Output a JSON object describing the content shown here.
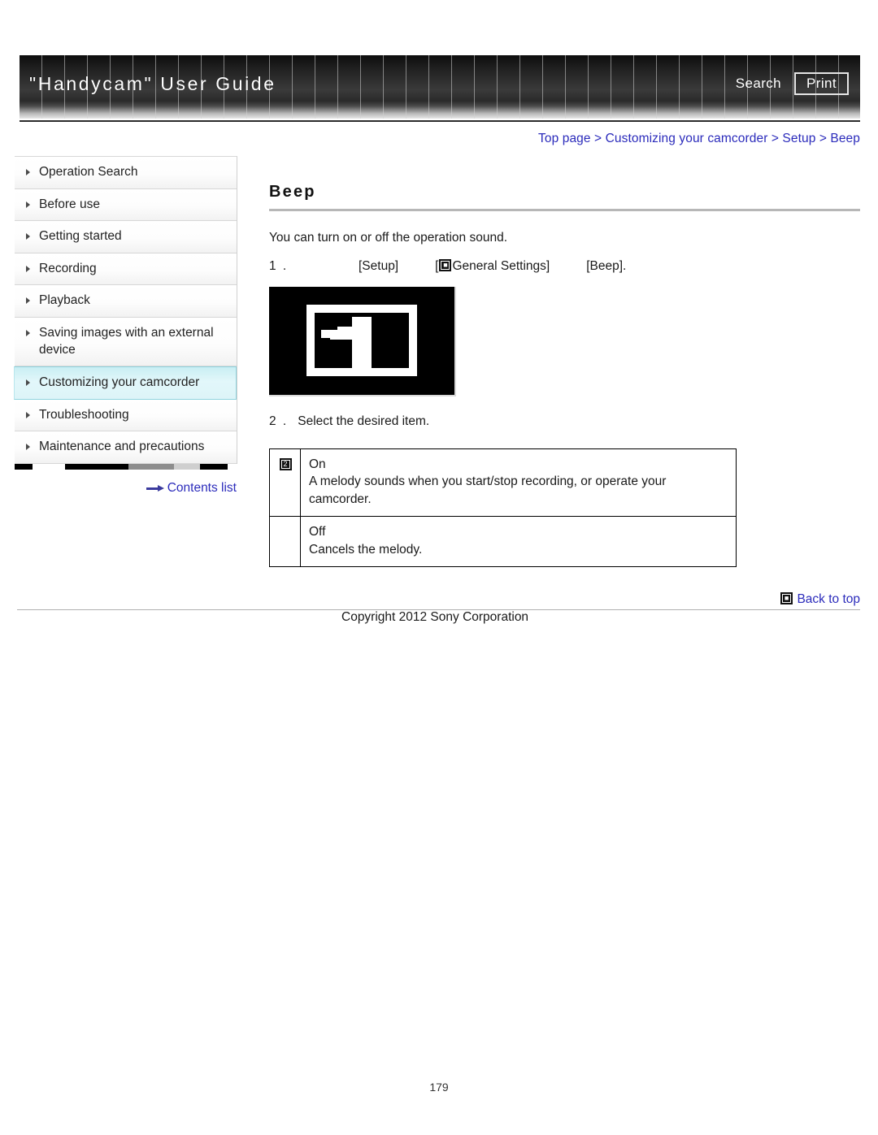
{
  "header": {
    "title": "\"Handycam\" User Guide",
    "search_label": "Search",
    "print_label": "Print"
  },
  "breadcrumb": {
    "text": "Top page > Customizing your camcorder > Setup > Beep",
    "color": "#2b2bbb"
  },
  "sidebar": {
    "items": [
      {
        "label": "Operation Search",
        "active": false
      },
      {
        "label": "Before use",
        "active": false
      },
      {
        "label": "Getting started",
        "active": false
      },
      {
        "label": "Recording",
        "active": false
      },
      {
        "label": "Playback",
        "active": false
      },
      {
        "label": "Saving images with an external device",
        "active": false
      },
      {
        "label": "Customizing your camcorder",
        "active": true
      },
      {
        "label": "Troubleshooting",
        "active": false
      },
      {
        "label": "Maintenance and precautions",
        "active": false
      }
    ],
    "contents_link": "Contents list",
    "active_highlight_color": "#d9f4f8"
  },
  "main": {
    "title": "Beep",
    "intro": "You can turn on or off the operation sound.",
    "step1": {
      "number": "1 .",
      "segment1": "[Setup]",
      "icon_name": "general-settings-icon",
      "icon_glyph": "■",
      "segment2": "General Settings]",
      "segment2_prefix": "[",
      "segment3": "[Beep]."
    },
    "screen_image_alt": "camcorder-screen-illustration",
    "step2": {
      "number": "2 .",
      "text": "Select the desired item."
    },
    "options": [
      {
        "icon": "option-marker-icon",
        "icon_glyph": "2",
        "name": "On",
        "description": "A melody sounds when you start/stop recording, or operate your camcorder."
      },
      {
        "icon": "",
        "icon_glyph": "",
        "name": "Off",
        "description": "Cancels the melody."
      }
    ]
  },
  "footer": {
    "back_to_top": "Back to top",
    "back_to_top_icon": "back-to-top-icon",
    "copyright": "Copyright 2012 Sony Corporation",
    "page_number": "179"
  }
}
